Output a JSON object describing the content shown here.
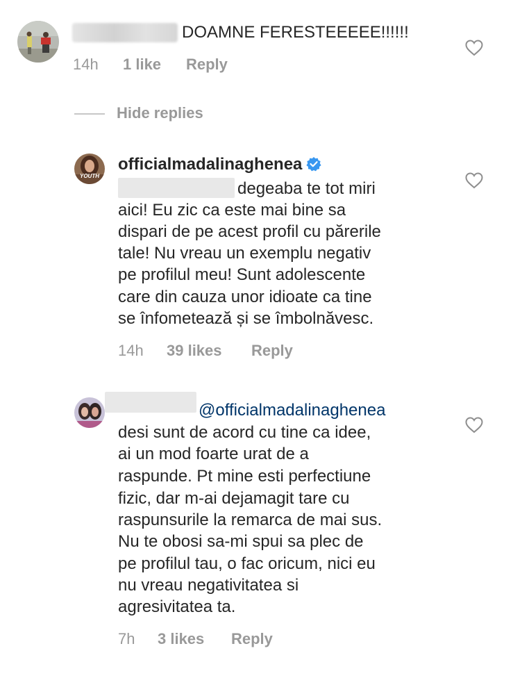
{
  "comment1": {
    "text": "DOAMNE FERESTEEEEE!!!!!!",
    "time": "14h",
    "likes": "1 like",
    "reply": "Reply"
  },
  "thread": {
    "hide_replies": "Hide replies"
  },
  "reply1": {
    "username": "officialmadalinaghenea",
    "avatar_badge": "YOUTH",
    "lines": [
      "degeaba te tot miri",
      "aici! Eu zic ca este mai bine sa",
      "dispari de pe acest profil cu părerile",
      "tale! Nu vreau un exemplu negativ",
      "pe profilul meu! Sunt adolescente",
      "care din cauza unor idioate ca tine",
      "se înfometează și se îmbolnăvesc."
    ],
    "time": "14h",
    "likes": "39 likes",
    "reply": "Reply"
  },
  "reply2": {
    "mention": "@officialmadalinaghenea",
    "lines": [
      "desi sunt de acord cu tine ca idee,",
      "ai un mod foarte urat de a",
      "raspunde. Pt mine esti perfectiune",
      "fizic, dar m-ai dejamagit tare cu",
      "raspunsurile la remarca de mai sus.",
      "Nu te obosi sa-mi spui sa plec de",
      "pe profilul tau, o fac oricum, nici eu",
      "nu vreau negativitatea si",
      "agresivitatea ta."
    ],
    "time": "7h",
    "likes": "3 likes",
    "reply": "Reply"
  },
  "colors": {
    "text": "#262626",
    "meta": "#999999",
    "mention": "#003569",
    "verified": "#3897f0"
  },
  "icons": [
    "heart-outline-icon",
    "verified-badge-icon"
  ]
}
